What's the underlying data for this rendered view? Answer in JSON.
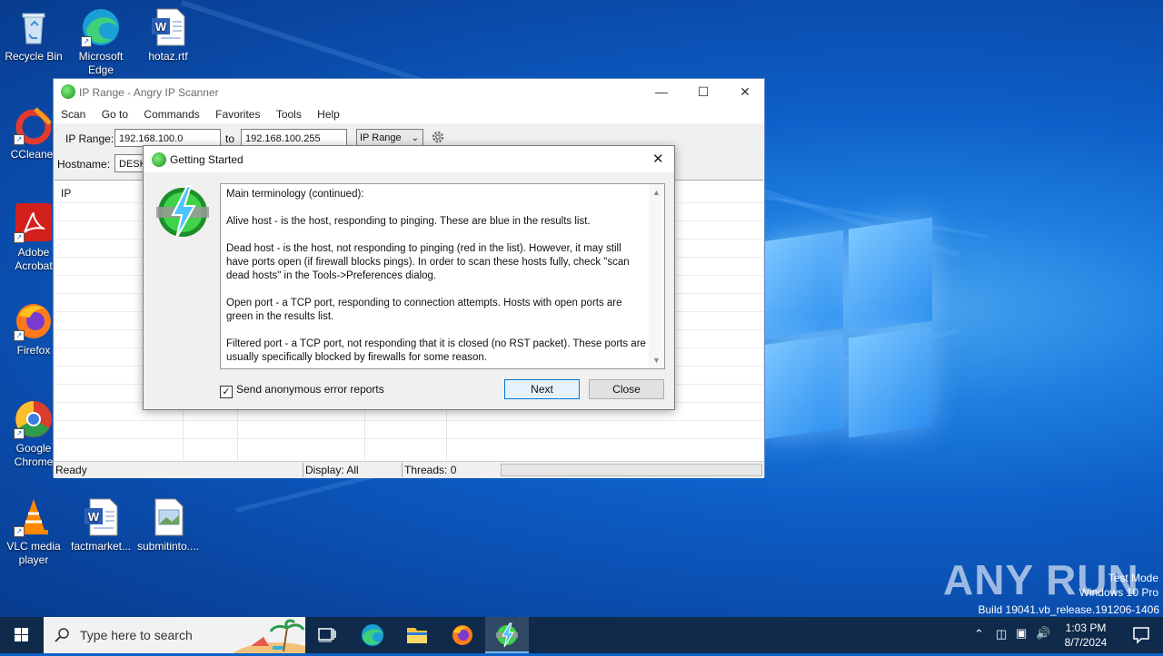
{
  "desktop": {
    "icons": [
      {
        "label": "Recycle Bin"
      },
      {
        "label": "Microsoft Edge"
      },
      {
        "label": "hotaz.rtf"
      },
      {
        "label": "CCleaner"
      },
      {
        "label": "Adobe Acrobat"
      },
      {
        "label": "Firefox"
      },
      {
        "label": "Google Chrome"
      },
      {
        "label": "VLC media player"
      },
      {
        "label": "factmarket..."
      },
      {
        "label": "submitinto...."
      }
    ]
  },
  "main_window": {
    "title": "IP Range - Angry IP Scanner",
    "menu": [
      "Scan",
      "Go to",
      "Commands",
      "Favorites",
      "Tools",
      "Help"
    ],
    "toolbar": {
      "ip_range_label": "IP Range:",
      "ip_from": "192.168.100.0",
      "to_label": "to",
      "ip_to": "192.168.100.255",
      "mode_select": "IP Range",
      "hostname_label": "Hostname:",
      "hostname_value": "DESK"
    },
    "results_header": "IP",
    "status": {
      "state": "Ready",
      "display": "Display: All",
      "threads": "Threads: 0"
    }
  },
  "dialog": {
    "title": "Getting Started",
    "paragraphs": [
      "Main terminology (continued):",
      "Alive host - is the host, responding to pinging. These are blue in the results list.",
      "Dead host - is the host, not responding to pinging (red in the list). However, it may still have ports open (if firewall blocks pings). In order to scan these hosts fully, check \"scan dead hosts\" in the Tools->Preferences dialog.",
      "Open port - a TCP port, responding to connection attempts. Hosts with open ports are green in the results list.",
      "Filtered port - a TCP port, not responding that it is closed (no RST packet). These ports are usually specifically blocked by firewalls for some reason."
    ],
    "checkbox_label": "Send anonymous error reports",
    "checkbox_checked": true,
    "next_label": "Next",
    "close_label": "Close"
  },
  "taskbar": {
    "search_placeholder": "Type here to search",
    "time": "1:03 PM",
    "date": "8/7/2024"
  },
  "watermark": {
    "mode": "Test Mode",
    "edition": "Windows 10 Pro",
    "build": "Build 19041.vb_release.191206-1406",
    "brand": "ANY RUN"
  }
}
